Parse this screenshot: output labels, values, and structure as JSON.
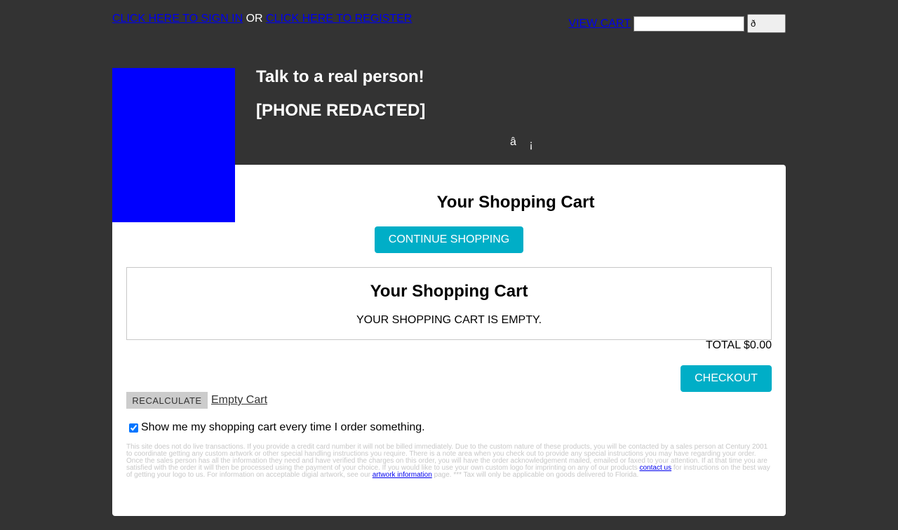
{
  "header": {
    "sign_in_link": "CLICK HERE TO SIGN IN",
    "or_text": "OR",
    "register_link": "CLICK HERE TO REGISTER",
    "view_cart_link": "VIEW CART",
    "search_value": "",
    "search_button": "ð"
  },
  "contact": {
    "heading": "Talk to a real person!",
    "phone": "[PHONE REDACTED]",
    "glyph_a": "â",
    "glyph_b": "¡"
  },
  "cart": {
    "page_title": "Your Shopping Cart",
    "continue_button": "CONTINUE SHOPPING",
    "box_title": "Your Shopping Cart",
    "empty_message": "YOUR SHOPPING CART IS EMPTY.",
    "total_label": "TOTAL",
    "total_value": "$0.00",
    "checkout_button": "CHECKOUT",
    "recalculate_button": "RECALCULATE",
    "empty_cart_link": "Empty Cart",
    "show_cart_checkbox_label": "Show me my shopping cart every time I order something.",
    "show_cart_checked": true
  },
  "disclaimer": {
    "part1": "This site does not do live transactions. If you provide a credit card number it will not be billed immediately. Due to the custom nature of these products, you will be contacted by a sales person at Century 2001 to coordinate getting any custom artwork or other special handling instructions you require. There is a note area when you check out to provide any special instructions you may have regarding your order. Once the sales person has all the information they need and have verified the charges on this order, you will have the order acknowledgement mailed, emailed or faxed to your attention. If at that time you are satisfied with the order it will then be processed using the payment of your choice. If you would like to use your own custom logo for imprinting on any of our products",
    "contact_link": "contact us",
    "part2": "for instructions on the best way of getting your logo to us. For information on acceptable digial artwork, see our",
    "artwork_link": "artwork information",
    "part3": "page. *** Tax will only be applicable on goods delivered to Florida."
  },
  "colors": {
    "background": "#333333",
    "accent_button": "#00aec7",
    "logo_placeholder": "#0000ff",
    "link": "#0000ee"
  }
}
